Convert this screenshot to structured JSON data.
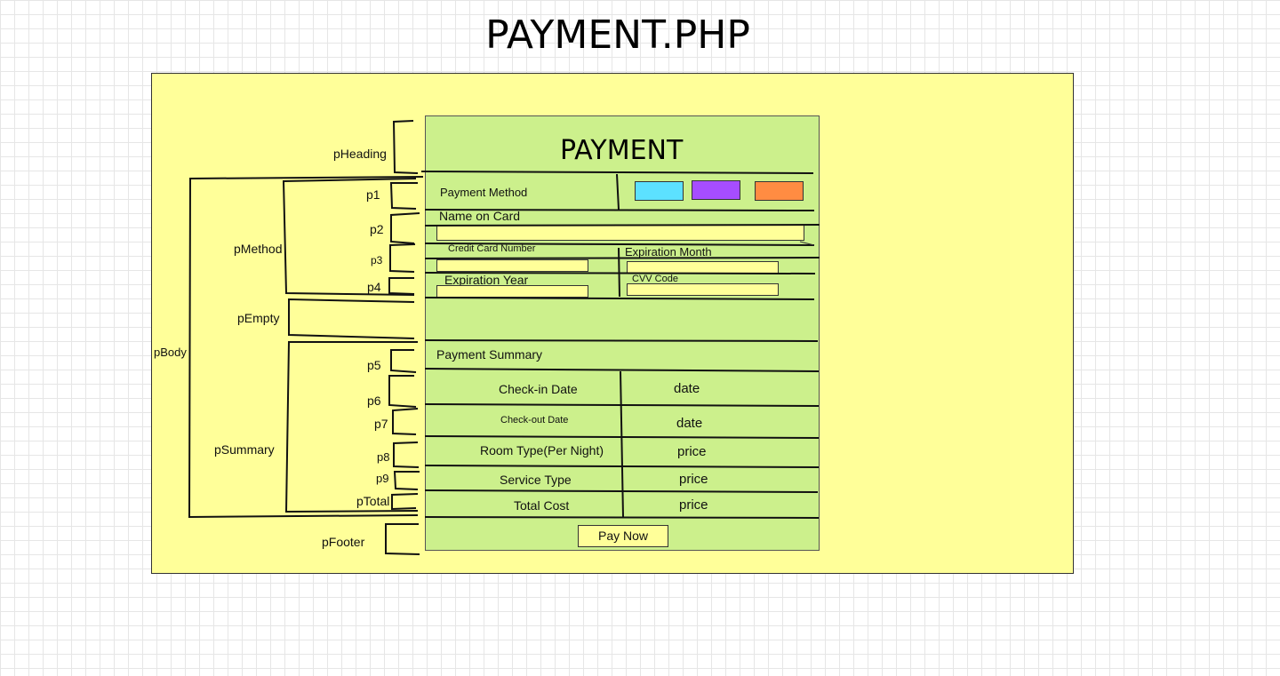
{
  "title": "PAYMENT.PHP",
  "form": {
    "heading": "PAYMENT",
    "payment_method_label": "Payment Method",
    "method_colors": [
      "#5ce1ff",
      "#a64dff",
      "#ff8c42"
    ],
    "name_on_card_label": "Name on Card",
    "credit_card_number_label": "Credit Card Number",
    "expiration_month_label": "Expiration Month",
    "expiration_year_label": "Expiration Year",
    "cvv_label": "CVV Code",
    "summary_heading": "Payment Summary",
    "rows": [
      {
        "label": "Check-in Date",
        "value": "date"
      },
      {
        "label": "Check-out Date",
        "value": "date"
      },
      {
        "label": "Room Type(Per Night)",
        "value": "price"
      },
      {
        "label": "Service Type",
        "value": "price"
      },
      {
        "label": "Total Cost",
        "value": "price"
      }
    ],
    "pay_button": "Pay Now"
  },
  "annotations": {
    "pHeading": "pHeading",
    "p1": "p1",
    "p2": "p2",
    "p3": "p3",
    "p4": "p4",
    "pMethod": "pMethod",
    "pEmpty": "pEmpty",
    "pBody": "pBody",
    "p5": "p5",
    "p6": "p6",
    "p7": "p7",
    "p8": "p8",
    "p9": "p9",
    "pTotal": "pTotal",
    "pSummary": "pSummary",
    "pFooter": "pFooter"
  }
}
